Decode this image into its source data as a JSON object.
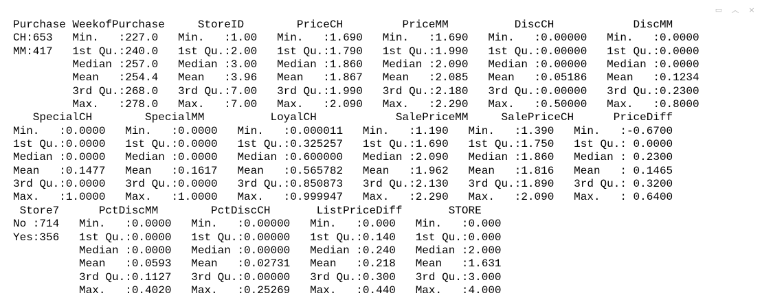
{
  "toolbar": {
    "icons": [
      "pane-icon",
      "chevron-up-icon",
      "close-icon"
    ]
  },
  "console": {
    "lines": [
      "Purchase WeekofPurchase     StoreID        PriceCH         PriceMM          DiscCH            DiscMM",
      "CH:653   Min.   :227.0   Min.   :1.00   Min.   :1.690   Min.   :1.690   Min.   :0.00000   Min.   :0.0000",
      "MM:417   1st Qu.:240.0   1st Qu.:2.00   1st Qu.:1.790   1st Qu.:1.990   1st Qu.:0.00000   1st Qu.:0.0000",
      "         Median :257.0   Median :3.00   Median :1.860   Median :2.090   Median :0.00000   Median :0.0000",
      "         Mean   :254.4   Mean   :3.96   Mean   :1.867   Mean   :2.085   Mean   :0.05186   Mean   :0.1234",
      "         3rd Qu.:268.0   3rd Qu.:7.00   3rd Qu.:1.990   3rd Qu.:2.180   3rd Qu.:0.00000   3rd Qu.:0.2300",
      "         Max.   :278.0   Max.   :7.00   Max.   :2.090   Max.   :2.290   Max.   :0.50000   Max.   :0.8000",
      "   SpecialCH        SpecialMM          LoyalCH            SalePriceMM     SalePriceCH      PriceDiff",
      "Min.   :0.0000   Min.   :0.0000   Min.   :0.000011   Min.   :1.190   Min.   :1.390   Min.   :-0.6700",
      "1st Qu.:0.0000   1st Qu.:0.0000   1st Qu.:0.325257   1st Qu.:1.690   1st Qu.:1.750   1st Qu.: 0.0000",
      "Median :0.0000   Median :0.0000   Median :0.600000   Median :2.090   Median :1.860   Median : 0.2300",
      "Mean   :0.1477   Mean   :0.1617   Mean   :0.565782   Mean   :1.962   Mean   :1.816   Mean   : 0.1465",
      "3rd Qu.:0.0000   3rd Qu.:0.0000   3rd Qu.:0.850873   3rd Qu.:2.130   3rd Qu.:1.890   3rd Qu.: 0.3200",
      "Max.   :1.0000   Max.   :1.0000   Max.   :0.999947   Max.   :2.290   Max.   :2.090   Max.   : 0.6400",
      " Store7      PctDiscMM        PctDiscCH       ListPriceDiff       STORE",
      "No :714   Min.   :0.0000   Min.   :0.00000   Min.   :0.000   Min.   :0.000",
      "Yes:356   1st Qu.:0.0000   1st Qu.:0.00000   1st Qu.:0.140   1st Qu.:0.000",
      "          Median :0.0000   Median :0.00000   Median :0.240   Median :2.000",
      "          Mean   :0.0593   Mean   :0.02731   Mean   :0.218   Mean   :1.631",
      "          3rd Qu.:0.1127   3rd Qu.:0.00000   3rd Qu.:0.300   3rd Qu.:3.000",
      "          Max.   :0.4020   Max.   :0.25269   Max.   :0.440   Max.   :4.000"
    ]
  }
}
